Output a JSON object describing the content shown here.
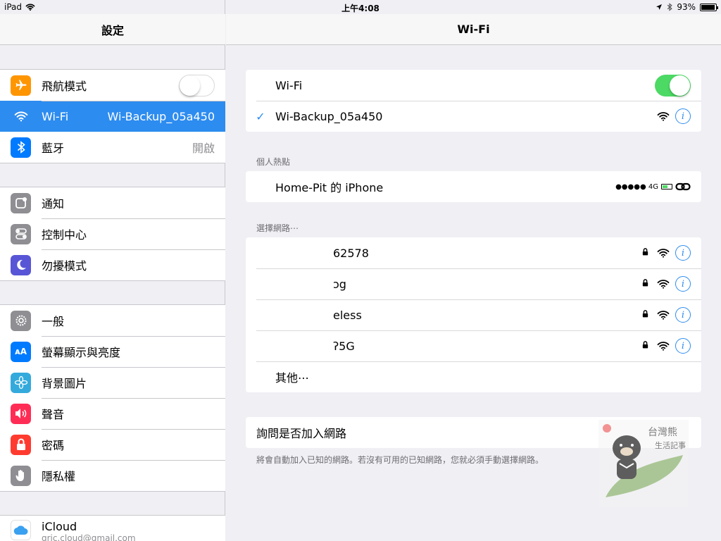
{
  "status": {
    "device": "iPad",
    "time": "上午4:08",
    "battery": "93%"
  },
  "sidebar": {
    "title": "設定",
    "groups": [
      [
        {
          "label": "飛航模式",
          "icon": "airplane-icon",
          "color": "#ff9500",
          "control": "toggle-off"
        },
        {
          "label": "Wi-Fi",
          "value": "Wi-Backup_05a450",
          "icon": "wifi-icon",
          "color": "#2d8cf0",
          "selected": true
        },
        {
          "label": "藍牙",
          "value": "開啟",
          "icon": "bluetooth-icon",
          "color": "#007aff"
        }
      ],
      [
        {
          "label": "通知",
          "icon": "notifications-icon",
          "color": "#8e8e93"
        },
        {
          "label": "控制中心",
          "icon": "control-center-icon",
          "color": "#8e8e93"
        },
        {
          "label": "勿擾模式",
          "icon": "moon-icon",
          "color": "#5856d6"
        }
      ],
      [
        {
          "label": "一般",
          "icon": "gear-icon",
          "color": "#8e8e93"
        },
        {
          "label": "螢幕顯示與亮度",
          "icon": "display-icon",
          "color": "#007aff"
        },
        {
          "label": "背景圖片",
          "icon": "wallpaper-icon",
          "color": "#34aadc"
        },
        {
          "label": "聲音",
          "icon": "speaker-icon",
          "color": "#ff2d55"
        },
        {
          "label": "密碼",
          "icon": "lock-icon",
          "color": "#ff3b30"
        },
        {
          "label": "隱私權",
          "icon": "hand-icon",
          "color": "#8e8e93"
        }
      ]
    ],
    "icloud": {
      "label": "iCloud",
      "email": "gric.cloud@gmail.com"
    }
  },
  "main": {
    "title": "Wi-Fi",
    "wifi_label": "Wi-Fi",
    "wifi_on": true,
    "connected": "Wi-Backup_05a450",
    "hotspot_title": "個人熱點",
    "hotspot_name": "Home-Pit 的 iPhone",
    "hotspot_signal": "●●●●● 4G",
    "choose_title": "選擇網路⋯",
    "networks": [
      "62578",
      "ɔg",
      "eless",
      "ʔ5G"
    ],
    "other": "其他⋯",
    "ask_label": "詢問是否加入網路",
    "ask_note": "將會自動加入已知的網路。若沒有可用的已知網路，您就必須手動選擇網路。"
  },
  "colors": {
    "accent": "#2d8cf0",
    "toggle_on": "#4cd964"
  }
}
